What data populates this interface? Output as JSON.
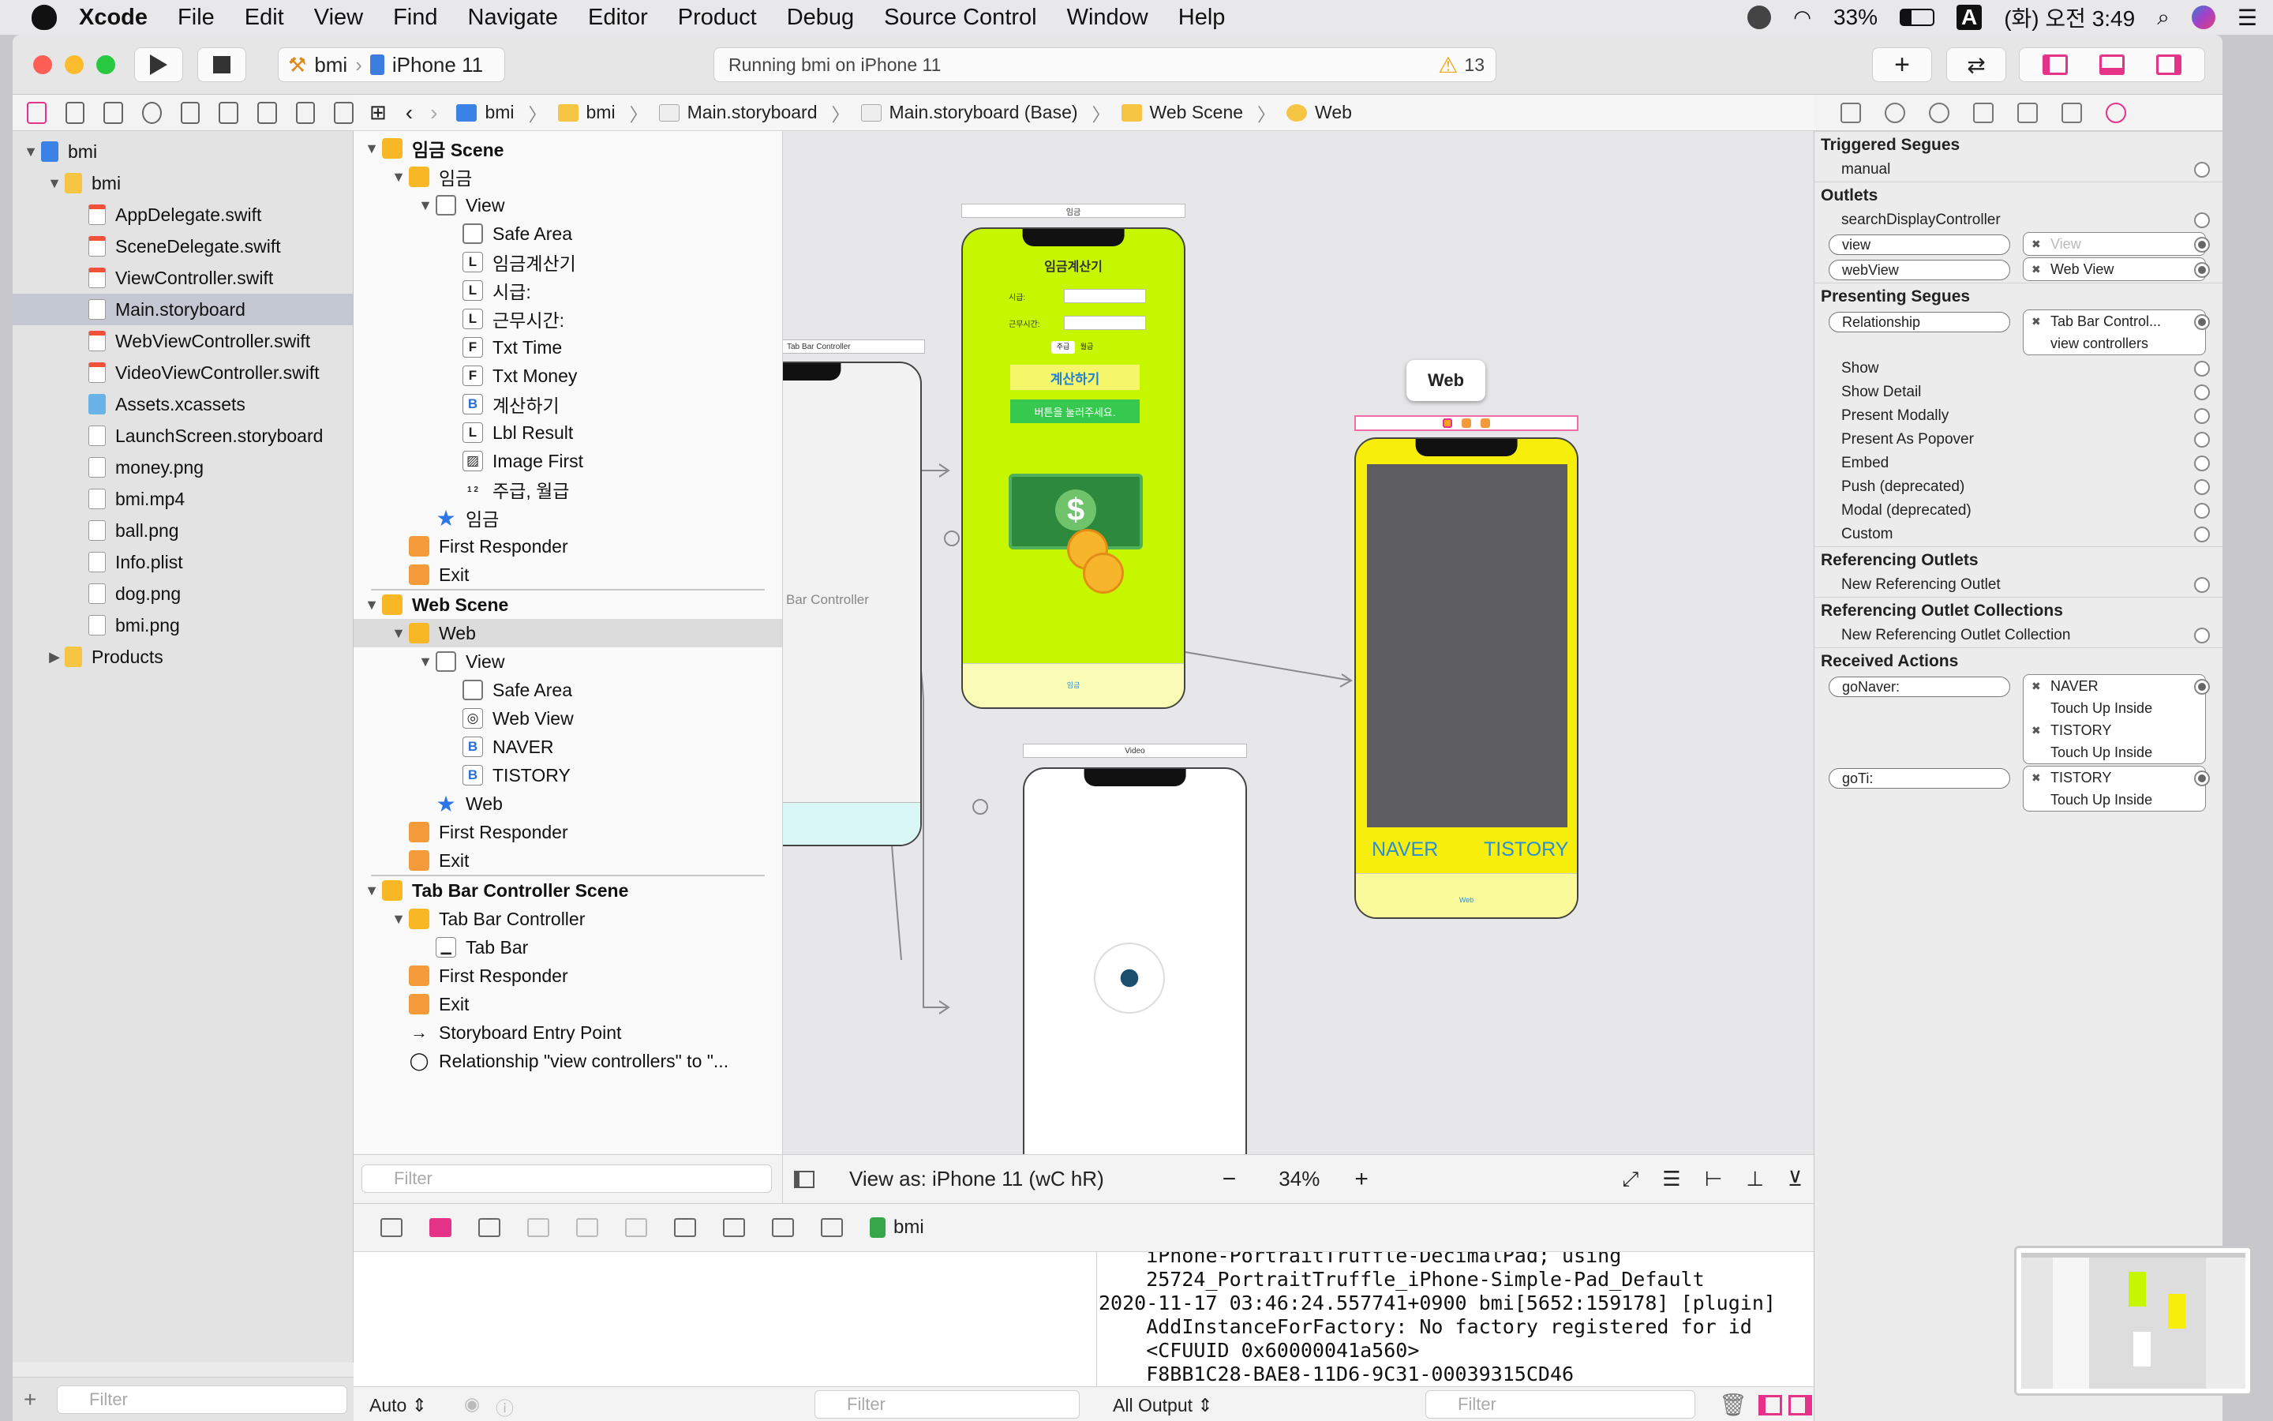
{
  "menubar": {
    "items": [
      "Xcode",
      "File",
      "Edit",
      "View",
      "Find",
      "Navigate",
      "Editor",
      "Product",
      "Debug",
      "Source Control",
      "Window",
      "Help"
    ],
    "battery": "33%",
    "input_source": "A",
    "clock": "(화) 오전 3:49"
  },
  "toolbar": {
    "scheme": "bmi",
    "device": "iPhone 11",
    "status": "Running bmi on iPhone 11",
    "warnings": "13",
    "accent": "#e6338a"
  },
  "navigator": {
    "items": [
      {
        "label": "bmi",
        "level": 0,
        "kind": "project",
        "open": true
      },
      {
        "label": "bmi",
        "level": 1,
        "kind": "folder",
        "open": true
      },
      {
        "label": "AppDelegate.swift",
        "level": 2,
        "kind": "swift"
      },
      {
        "label": "SceneDelegate.swift",
        "level": 2,
        "kind": "swift"
      },
      {
        "label": "ViewController.swift",
        "level": 2,
        "kind": "swift"
      },
      {
        "label": "Main.storyboard",
        "level": 2,
        "kind": "storyboard",
        "selected": true
      },
      {
        "label": "WebViewController.swift",
        "level": 2,
        "kind": "swift"
      },
      {
        "label": "VideoViewController.swift",
        "level": 2,
        "kind": "swift"
      },
      {
        "label": "Assets.xcassets",
        "level": 2,
        "kind": "assets"
      },
      {
        "label": "LaunchScreen.storyboard",
        "level": 2,
        "kind": "storyboard"
      },
      {
        "label": "money.png",
        "level": 2,
        "kind": "image"
      },
      {
        "label": "bmi.mp4",
        "level": 2,
        "kind": "movie"
      },
      {
        "label": "ball.png",
        "level": 2,
        "kind": "image"
      },
      {
        "label": "Info.plist",
        "level": 2,
        "kind": "plist"
      },
      {
        "label": "dog.png",
        "level": 2,
        "kind": "image"
      },
      {
        "label": "bmi.png",
        "level": 2,
        "kind": "image"
      },
      {
        "label": "Products",
        "level": 1,
        "kind": "folder",
        "open": false
      }
    ],
    "filter_placeholder": "Filter"
  },
  "jumpbar": {
    "crumbs": [
      "bmi",
      "bmi",
      "Main.storyboard",
      "Main.storyboard (Base)",
      "Web Scene",
      "Web"
    ]
  },
  "outline": {
    "rows": [
      {
        "label": "임금 Scene",
        "level": 0,
        "icon": "y",
        "scene": true,
        "tri": "open"
      },
      {
        "label": "임금",
        "level": 1,
        "icon": "y",
        "tri": "open"
      },
      {
        "label": "View",
        "level": 2,
        "icon": "g",
        "tri": "open"
      },
      {
        "label": "Safe Area",
        "level": 3,
        "icon": "g"
      },
      {
        "label": "임금계산기",
        "level": 3,
        "icon": "l",
        "glyph": "L"
      },
      {
        "label": "시급:",
        "level": 3,
        "icon": "l",
        "glyph": "L"
      },
      {
        "label": "근무시간:",
        "level": 3,
        "icon": "l",
        "glyph": "L"
      },
      {
        "label": "Txt Time",
        "level": 3,
        "icon": "l",
        "glyph": "F"
      },
      {
        "label": "Txt Money",
        "level": 3,
        "icon": "l",
        "glyph": "F"
      },
      {
        "label": "계산하기",
        "level": 3,
        "icon": "b",
        "glyph": "B"
      },
      {
        "label": "Lbl Result",
        "level": 3,
        "icon": "l",
        "glyph": "L"
      },
      {
        "label": "Image First",
        "level": 3,
        "icon": "l",
        "glyph": "▨"
      },
      {
        "label": "주급, 월급",
        "level": 3,
        "icon": "l",
        "glyph": "1 2"
      },
      {
        "label": "임금",
        "level": 2,
        "icon": "st",
        "glyph": "★"
      },
      {
        "label": "First Responder",
        "level": 1,
        "icon": "o"
      },
      {
        "label": "Exit",
        "level": 1,
        "icon": "o"
      },
      {
        "label": "Web Scene",
        "level": 0,
        "icon": "y",
        "scene": true,
        "tri": "open",
        "divider": true
      },
      {
        "label": "Web",
        "level": 1,
        "icon": "y",
        "tri": "open",
        "selected": true
      },
      {
        "label": "View",
        "level": 2,
        "icon": "g",
        "tri": "open"
      },
      {
        "label": "Safe Area",
        "level": 3,
        "icon": "g"
      },
      {
        "label": "Web View",
        "level": 3,
        "icon": "l",
        "glyph": "◎"
      },
      {
        "label": "NAVER",
        "level": 3,
        "icon": "b",
        "glyph": "B"
      },
      {
        "label": "TISTORY",
        "level": 3,
        "icon": "b",
        "glyph": "B"
      },
      {
        "label": "Web",
        "level": 2,
        "icon": "st",
        "glyph": "★"
      },
      {
        "label": "First Responder",
        "level": 1,
        "icon": "o"
      },
      {
        "label": "Exit",
        "level": 1,
        "icon": "o"
      },
      {
        "label": "Tab Bar Controller Scene",
        "level": 0,
        "icon": "y",
        "scene": true,
        "tri": "open",
        "divider": true
      },
      {
        "label": "Tab Bar Controller",
        "level": 1,
        "icon": "y",
        "tri": "open"
      },
      {
        "label": "Tab Bar",
        "level": 2,
        "icon": "l",
        "glyph": "▁"
      },
      {
        "label": "First Responder",
        "level": 1,
        "icon": "o"
      },
      {
        "label": "Exit",
        "level": 1,
        "icon": "o"
      },
      {
        "label": "Storyboard Entry Point",
        "level": 1,
        "icon": "arrow",
        "glyph": "→"
      },
      {
        "label": "Relationship \"view controllers\" to \"...",
        "level": 1,
        "icon": "circle",
        "glyph": "◯"
      }
    ],
    "filter_placeholder": "Filter"
  },
  "canvas": {
    "view_as": "View as: iPhone 11 (wC hR)",
    "zoom": "34%",
    "tab_bar_controller_label": "Bar Controller",
    "tab_tag": "Tab Bar Controller",
    "wage_tag": "임금",
    "wage_title": "임금계산기",
    "wage_label_rate": "시급:",
    "wage_label_hours": "근무시간:",
    "wage_seg": [
      "주급",
      "월급"
    ],
    "wage_button": "계산하기",
    "wage_result": "버튼을 눌러주세요.",
    "wage_tab": "임금",
    "web_popup": "Web",
    "naver": "NAVER",
    "tistory": "TISTORY",
    "web_tab": "Web",
    "video_tag": "Video",
    "colors": {
      "lime": "#c6f700",
      "yellow": "#f7ee0c",
      "webview": "#5d5d5f",
      "link": "#2b8fd6"
    }
  },
  "debug": {
    "target": "bmi",
    "console_lines": [
      "    iPhone-PortraitTruffle-DecimalPad; using",
      "    25724_PortraitTruffle_iPhone-Simple-Pad_Default",
      "2020-11-17 03:46:24.557741+0900 bmi[5652:159178] [plugin]",
      "    AddInstanceForFactory: No factory registered for id",
      "    <CFUUID 0x60000041a560>",
      "    F8BB1C28-BAE8-11D6-9C31-00039315CD46"
    ],
    "auto_label": "Auto",
    "output_label": "All Output",
    "filter_placeholder": "Filter"
  },
  "inspector": {
    "sections": [
      {
        "title": "Triggered Segues",
        "rows": [
          {
            "label": "manual"
          }
        ]
      },
      {
        "title": "Outlets",
        "rows": [
          {
            "label": "searchDisplayController"
          },
          {
            "label": "view",
            "pill": true,
            "target": [
              "View"
            ],
            "dim": true
          },
          {
            "label": "webView",
            "pill": true,
            "target": [
              "Web View"
            ]
          }
        ]
      },
      {
        "title": "Presenting Segues",
        "rows": [
          {
            "label": "Relationship",
            "pill": true,
            "target": [
              "Tab Bar Control...",
              "view controllers"
            ]
          },
          {
            "label": "Show"
          },
          {
            "label": "Show Detail"
          },
          {
            "label": "Present Modally"
          },
          {
            "label": "Present As Popover"
          },
          {
            "label": "Embed"
          },
          {
            "label": "Push (deprecated)"
          },
          {
            "label": "Modal (deprecated)"
          },
          {
            "label": "Custom"
          }
        ]
      },
      {
        "title": "Referencing Outlets",
        "rows": [
          {
            "label": "New Referencing Outlet"
          }
        ]
      },
      {
        "title": "Referencing Outlet Collections",
        "rows": [
          {
            "label": "New Referencing Outlet Collection"
          }
        ]
      },
      {
        "title": "Received Actions",
        "rows": [
          {
            "label": "goNaver:",
            "pill": true,
            "target": [
              "NAVER",
              "Touch Up Inside",
              "TISTORY",
              "Touch Up Inside"
            ]
          },
          {
            "label": "goTi:",
            "pill": true,
            "target": [
              "TISTORY",
              "Touch Up Inside"
            ]
          }
        ]
      }
    ]
  }
}
